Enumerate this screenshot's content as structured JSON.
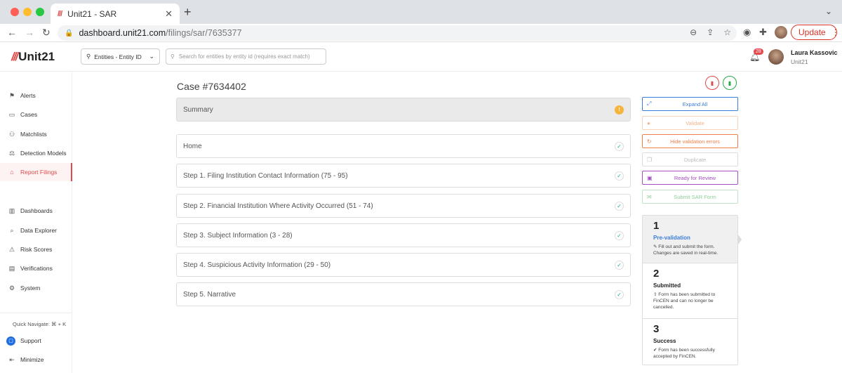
{
  "browser": {
    "tab_title": "Unit21 - SAR",
    "tab_logo": "///",
    "url_host": "dashboard.unit21.com",
    "url_path": "/filings/sar/7635377",
    "update_label": "Update"
  },
  "header": {
    "brand": "Unit21",
    "brand_mark": "///",
    "entity_select": "Entities - Entity ID",
    "search_placeholder": "Search for entities by entity id (requires exact match)",
    "notification_count": "28",
    "user_name": "Laura Kassovic",
    "user_org": "Unit21"
  },
  "sidebar": {
    "items": [
      {
        "label": "Alerts",
        "icon": "flag-icon"
      },
      {
        "label": "Cases",
        "icon": "briefcase-icon"
      },
      {
        "label": "Matchlists",
        "icon": "user-plus-icon"
      },
      {
        "label": "Detection Models",
        "icon": "scale-icon"
      },
      {
        "label": "Report Filings",
        "icon": "bank-icon"
      },
      {
        "label": "Dashboards",
        "icon": "chart-icon"
      },
      {
        "label": "Data Explorer",
        "icon": "search-data-icon"
      },
      {
        "label": "Risk Scores",
        "icon": "warning-icon"
      },
      {
        "label": "Verifications",
        "icon": "id-card-icon"
      },
      {
        "label": "System",
        "icon": "gear-icon"
      }
    ],
    "quick_navigate": "Quick Navigate: ⌘ + K",
    "support": "Support",
    "minimize": "Minimize"
  },
  "main": {
    "case_title": "Case #7634402",
    "sections": [
      {
        "label": "Summary",
        "status": "warning"
      },
      {
        "label": "Home",
        "status": "complete"
      },
      {
        "label": "Step 1. Filing Institution Contact Information (75 - 95)",
        "status": "complete"
      },
      {
        "label": "Step 2. Financial Institution Where Activity Occurred (51 - 74)",
        "status": "complete"
      },
      {
        "label": "Step 3. Subject Information (3 - 28)",
        "status": "complete"
      },
      {
        "label": "Step 4. Suspicious Activity Information (29 - 50)",
        "status": "complete"
      },
      {
        "label": "Step 5. Narrative",
        "status": "complete"
      }
    ],
    "actions": {
      "expand_all": "Expand All",
      "validate": "Validate",
      "hide_errors": "Hide validation errors",
      "duplicate": "Duplicate",
      "ready_review": "Ready for Review",
      "submit_sar": "Submit SAR Form"
    },
    "steps": [
      {
        "num": "1",
        "title": "Pre-validation",
        "desc": "Fill out and submit the form. Changes are saved in real-time."
      },
      {
        "num": "2",
        "title": "Submitted",
        "desc": "Form has been submitted to FinCEN and can no longer be cancelled."
      },
      {
        "num": "3",
        "title": "Success",
        "desc": "Form has been successfully accepted by FinCEN."
      }
    ]
  },
  "colors": {
    "brand_red": "#e04a4a",
    "accent_blue": "#3b7ddd",
    "check_teal": "#1fa89a"
  }
}
